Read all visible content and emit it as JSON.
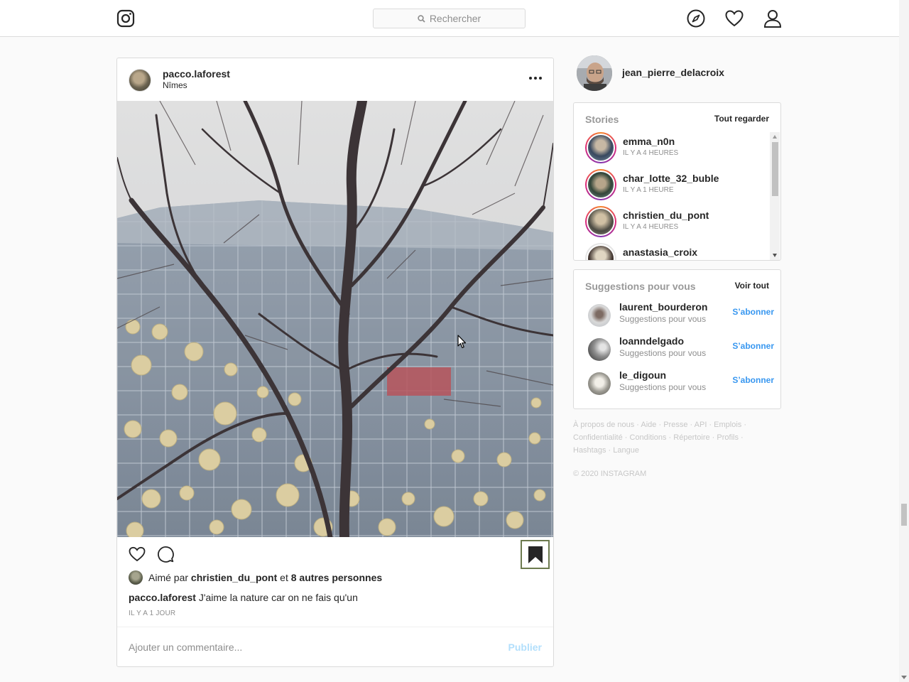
{
  "nav": {
    "logo_icon": "instagram-icon",
    "search_placeholder": "Rechercher",
    "icons": [
      "explore-compass-icon",
      "activity-heart-icon",
      "profile-icon"
    ]
  },
  "post": {
    "username": "pacco.laforest",
    "location": "Nîmes",
    "likes": {
      "prefix": "Aimé par",
      "liker": "christien_du_pont",
      "connector": "et",
      "others": "8 autres personnes"
    },
    "caption_user": "pacco.laforest",
    "caption_text": "J'aime la nature car on ne fais qu'un",
    "timestamp": "IL Y A 1 JOUR",
    "comment_placeholder": "Ajouter un commentaire...",
    "publish_label": "Publier"
  },
  "sidebar": {
    "me": {
      "username": "jean_pierre_delacroix"
    },
    "stories": {
      "title": "Stories",
      "see_all": "Tout regarder",
      "items": [
        {
          "username": "emma_n0n",
          "time": "IL Y A 4 HEURES"
        },
        {
          "username": "char_lotte_32_buble",
          "time": "IL Y A 1 HEURE"
        },
        {
          "username": "christien_du_pont",
          "time": "IL Y A 4 HEURES"
        },
        {
          "username": "anastasia_croix",
          "time": ""
        }
      ]
    },
    "suggestions": {
      "title": "Suggestions pour vous",
      "see_all": "Voir tout",
      "items": [
        {
          "username": "laurent_bourderon",
          "subtitle": "Suggestions pour vous",
          "action": "S’abonner"
        },
        {
          "username": "loanndelgado",
          "subtitle": "Suggestions pour vous",
          "action": "S’abonner"
        },
        {
          "username": "le_digoun",
          "subtitle": "Suggestions pour vous",
          "action": "S’abonner"
        }
      ]
    },
    "footer": {
      "links": [
        "À propos de nous",
        "Aide",
        "Presse",
        "API",
        "Emplois",
        "Confidentialité",
        "Conditions",
        "Répertoire",
        "Profils",
        "Hashtags",
        "Langue"
      ],
      "copyright": "© 2020 INSTAGRAM"
    }
  },
  "colors": {
    "link_blue": "#3897f0",
    "publish_disabled": "#b2dffc",
    "border": "#dbdbdb",
    "muted": "#8e8e8e"
  }
}
